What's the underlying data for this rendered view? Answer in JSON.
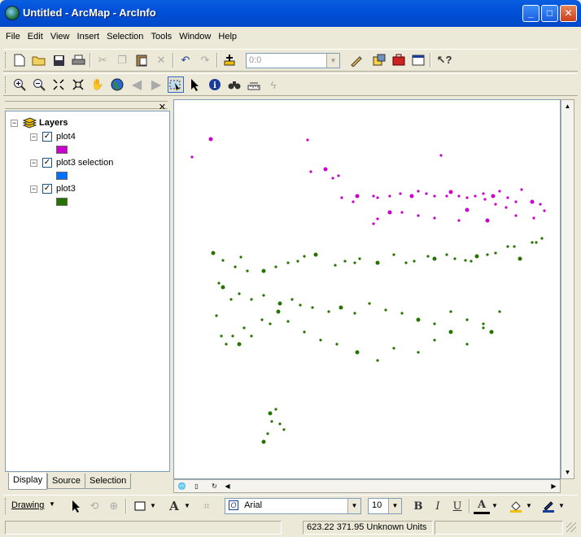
{
  "window": {
    "title": "Untitled - ArcMap - ArcInfo",
    "minimize": "_",
    "maximize": "□",
    "close": "✕"
  },
  "menu": [
    "File",
    "Edit",
    "View",
    "Insert",
    "Selection",
    "Tools",
    "Window",
    "Help"
  ],
  "toolbar": {
    "scale_value": "0:0"
  },
  "toc": {
    "root_label": "Layers",
    "layers": [
      {
        "name": "plot4",
        "checked": true,
        "color": "#CC00CC"
      },
      {
        "name": "plot3 selection",
        "checked": true,
        "color": "#0070FF"
      },
      {
        "name": "plot3",
        "checked": true,
        "color": "#267300"
      }
    ],
    "tabs": [
      "Display",
      "Source",
      "Selection"
    ],
    "active_tab": "Display"
  },
  "drawing": {
    "drawing_label": "Drawing",
    "font_name": "Arial",
    "font_size": "10",
    "bold": "B",
    "italic": "I",
    "underline": "U",
    "font_color_glyph": "A"
  },
  "status": {
    "coordinates": "623.22  371.95 Unknown Units"
  },
  "colors": {
    "plot4": "#CC00CC",
    "plot3": "#267300"
  },
  "chart_data": {
    "type": "scatter",
    "series": [
      {
        "name": "plot4",
        "x": [
          45,
          22,
          164,
          328,
          168,
          186,
          195,
          202,
          206,
          220,
          225,
          245,
          250,
          265,
          278,
          292,
          300,
          310,
          320,
          335,
          340,
          350,
          360,
          370,
          380,
          392,
          400,
          410,
          420,
          427,
          440,
          450,
          455,
          442,
          420,
          385,
          350,
          320,
          300,
          280,
          265,
          250,
          245,
          382,
          395,
          360,
          408
        ],
        "y": [
          48,
          70,
          49,
          68,
          88,
          85,
          96,
          93,
          120,
          125,
          118,
          118,
          120,
          118,
          115,
          118,
          112,
          115,
          118,
          118,
          113,
          118,
          120,
          118,
          115,
          118,
          112,
          120,
          125,
          110,
          125,
          128,
          136,
          145,
          142,
          148,
          148,
          145,
          142,
          138,
          138,
          146,
          152,
          122,
          128,
          135,
          132
        ]
      },
      {
        "name": "plot3",
        "x": [
          48,
          82,
          60,
          75,
          90,
          110,
          125,
          140,
          152,
          160,
          174,
          198,
          210,
          222,
          228,
          250,
          270,
          285,
          295,
          312,
          320,
          335,
          345,
          358,
          365,
          372,
          385,
          395,
          410,
          418,
          425,
          440,
          445,
          452,
          55,
          60,
          70,
          80,
          95,
          110,
          130,
          145,
          155,
          170,
          190,
          205,
          222,
          240,
          260,
          280,
          300,
          320,
          340,
          360,
          380,
          390,
          52,
          58,
          64,
          72,
          80,
          86,
          95,
          108,
          118,
          128,
          140,
          160,
          180,
          200,
          225,
          250,
          270,
          300,
          320,
          340,
          360,
          380,
          400,
          120,
          118,
          125,
          130,
          135,
          115,
          110
        ],
        "y": [
          188,
          193,
          197,
          205,
          210,
          210,
          205,
          200,
          198,
          192,
          190,
          203,
          198,
          200,
          195,
          200,
          190,
          200,
          198,
          192,
          195,
          190,
          195,
          197,
          198,
          192,
          190,
          188,
          180,
          180,
          195,
          175,
          175,
          170,
          225,
          230,
          245,
          238,
          245,
          240,
          250,
          245,
          252,
          255,
          260,
          255,
          262,
          250,
          258,
          262,
          270,
          275,
          260,
          270,
          280,
          285,
          265,
          290,
          300,
          290,
          300,
          280,
          290,
          270,
          275,
          260,
          272,
          285,
          295,
          300,
          310,
          320,
          305,
          310,
          295,
          285,
          300,
          275,
          260,
          395,
          385,
          380,
          398,
          405,
          410,
          420
        ]
      }
    ]
  }
}
